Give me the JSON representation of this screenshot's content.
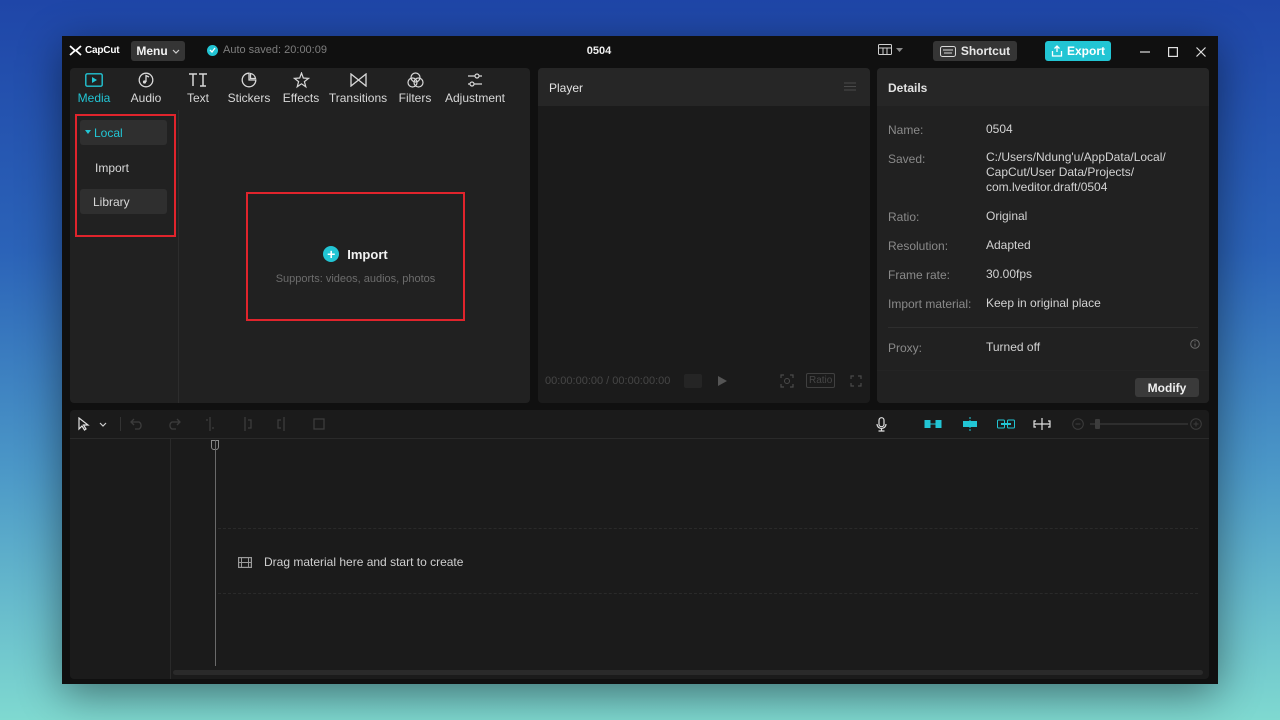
{
  "app": {
    "logo_text": "CapCut",
    "menu_label": "Menu",
    "autosave_text": "Auto saved: 20:00:09",
    "project_title": "0504"
  },
  "titlebar": {
    "shortcut_label": "Shortcut",
    "export_label": "Export"
  },
  "media": {
    "tabs": [
      {
        "label": "Media",
        "icon": "media-icon",
        "active": true
      },
      {
        "label": "Audio",
        "icon": "audio-icon"
      },
      {
        "label": "Text",
        "icon": "text-icon"
      },
      {
        "label": "Stickers",
        "icon": "stickers-icon"
      },
      {
        "label": "Effects",
        "icon": "effects-icon"
      },
      {
        "label": "Transitions",
        "icon": "transitions-icon"
      },
      {
        "label": "Filters",
        "icon": "filters-icon"
      },
      {
        "label": "Adjustment",
        "icon": "adjustment-icon"
      }
    ],
    "sidebar": {
      "local": "Local",
      "import": "Import",
      "library": "Library"
    },
    "import_box": {
      "title": "Import",
      "subtitle": "Supports: videos, audios, photos"
    }
  },
  "player": {
    "title": "Player",
    "timecode": "00:00:00:00 / 00:00:00:00",
    "ratio_label": "Ratio"
  },
  "details": {
    "title": "Details",
    "rows": [
      {
        "label": "Name:",
        "value": "0504"
      },
      {
        "label": "Saved:",
        "value": "C:/Users/Ndung'u/AppData/Local/ CapCut/User Data/Projects/ com.lveditor.draft/0504"
      },
      {
        "label": "Ratio:",
        "value": "Original"
      },
      {
        "label": "Resolution:",
        "value": "Adapted"
      },
      {
        "label": "Frame rate:",
        "value": "30.00fps"
      },
      {
        "label": "Import material:",
        "value": "Keep in original place"
      },
      {
        "label": "Proxy:",
        "value": "Turned off"
      }
    ],
    "modify_label": "Modify"
  },
  "timeline": {
    "drop_text": "Drag material here and start to create"
  },
  "colors": {
    "accent": "#22c5d4",
    "highlight": "#e0242c"
  }
}
